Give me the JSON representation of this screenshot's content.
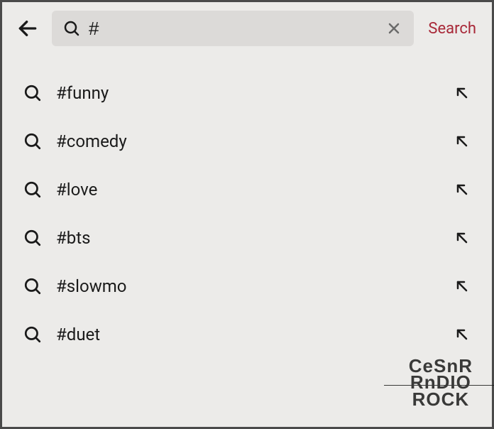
{
  "header": {
    "search_value": "#",
    "search_button_label": "Search"
  },
  "suggestions": [
    {
      "label": "#funny"
    },
    {
      "label": "#comedy"
    },
    {
      "label": "#love"
    },
    {
      "label": "#bts"
    },
    {
      "label": "#slowmo"
    },
    {
      "label": "#duet"
    }
  ],
  "watermark": {
    "line1": "CeSnR",
    "line2": "RnDIO",
    "line3": "ROCK"
  }
}
